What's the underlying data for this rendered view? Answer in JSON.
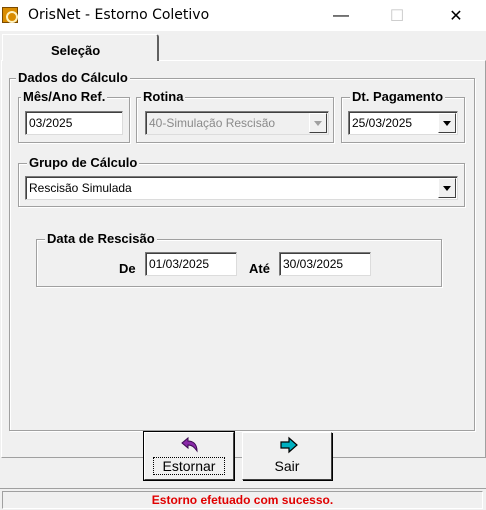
{
  "window": {
    "title": "OrisNet - Estorno Coletivo",
    "minimize_glyph": "—",
    "maximize_glyph": "☐",
    "close_glyph": "✕"
  },
  "tabs": [
    {
      "label": "Seleção",
      "active": true
    }
  ],
  "dados_calculo": {
    "legend": "Dados do Cálculo",
    "mes_ano": {
      "legend": "Mês/Ano Ref.",
      "value": "03/2025"
    },
    "rotina": {
      "legend": "Rotina",
      "value": "40-Simulação Rescisão",
      "enabled": false
    },
    "dt_pagamento": {
      "legend": "Dt. Pagamento",
      "value": "25/03/2025"
    },
    "grupo_calculo": {
      "legend": "Grupo de Cálculo",
      "value": "Rescisão Simulada"
    },
    "data_rescisao": {
      "legend": "Data de Rescisão",
      "de_label": "De",
      "de_value": "01/03/2025",
      "ate_label": "Até",
      "ate_value": "30/03/2025"
    }
  },
  "buttons": {
    "estornar": {
      "label": "Estornar",
      "icon": "undo-arrow-icon"
    },
    "sair": {
      "label": "Sair",
      "icon": "exit-arrow-icon"
    }
  },
  "status": {
    "message": "Estorno efetuado com sucesso.",
    "color": "#e00000"
  },
  "colors": {
    "face": "#f0f0f0",
    "accent_icon": "#00b0c0",
    "undo_icon": "#8a2aa8"
  }
}
